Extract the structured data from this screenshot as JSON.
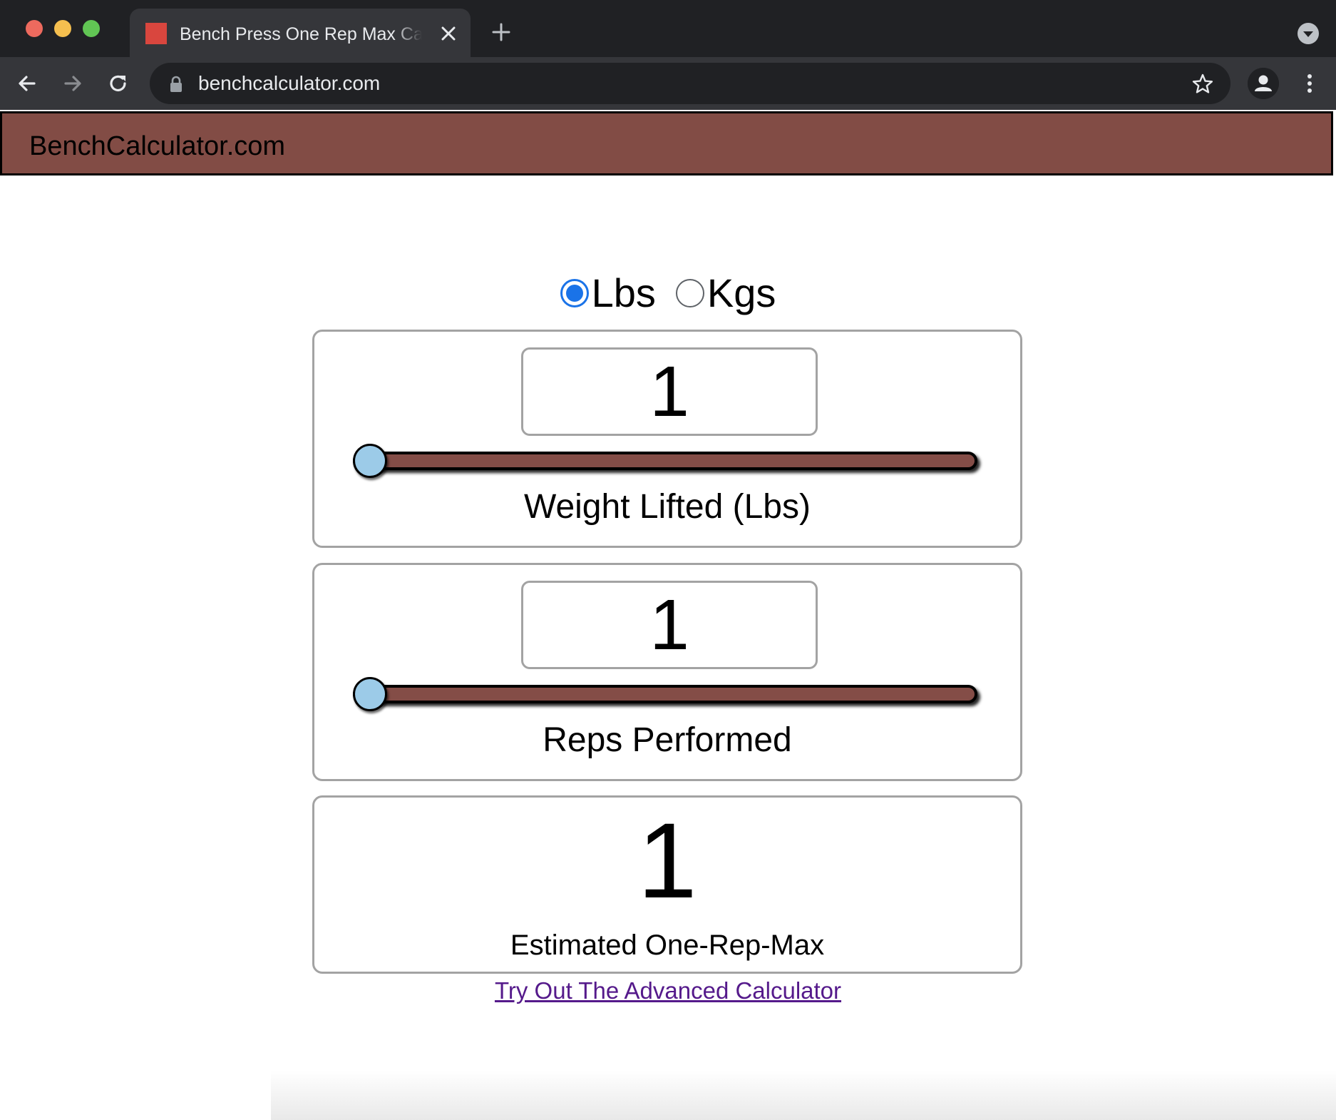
{
  "browser": {
    "tab_title": "Bench Press One Rep Max Calculator",
    "url": "benchcalculator.com",
    "icons": {
      "tab_close": "close-icon",
      "new_tab": "plus-icon",
      "tab_menu": "chevron-down-icon",
      "back": "arrow-left-icon",
      "forward": "arrow-right-icon",
      "reload": "reload-icon",
      "lock": "lock-icon",
      "bookmark": "star-icon",
      "profile": "person-icon",
      "menu": "kebab-menu-icon"
    }
  },
  "site": {
    "title": "BenchCalculator.com",
    "brand_color": "#824c45"
  },
  "units": {
    "options": [
      {
        "label": "Lbs",
        "checked": true
      },
      {
        "label": "Kgs",
        "checked": false
      }
    ]
  },
  "weight": {
    "value": "1",
    "label": "Weight Lifted (Lbs)",
    "slider_fraction": 0.0
  },
  "reps": {
    "value": "1",
    "label": "Reps Performed",
    "slider_fraction": 0.0
  },
  "result": {
    "value": "1",
    "label": "Estimated One-Rep-Max"
  },
  "advanced_link": "Try Out The Advanced Calculator"
}
